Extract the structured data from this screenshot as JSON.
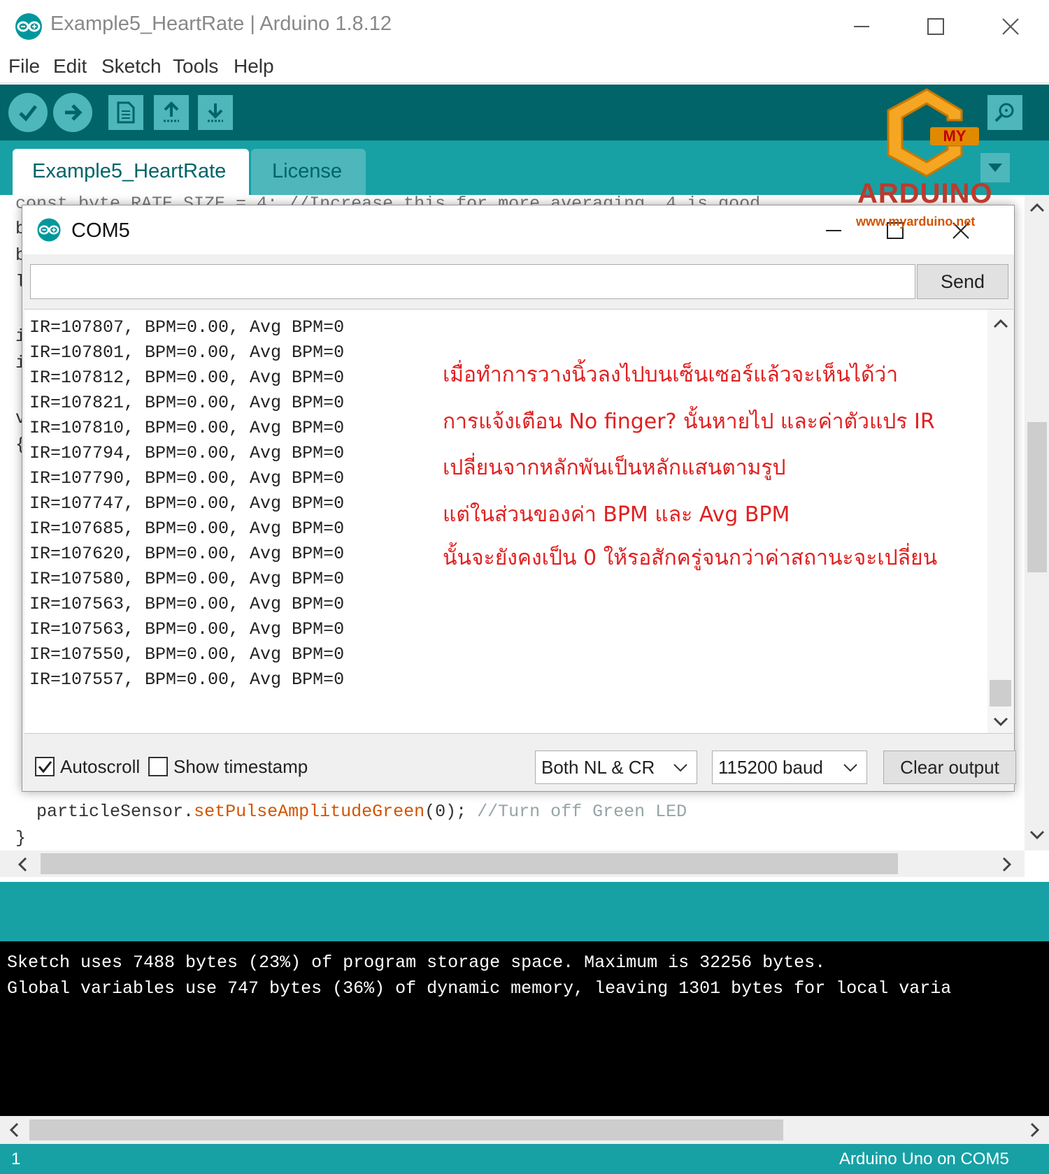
{
  "window": {
    "title": "Example5_HeartRate | Arduino 1.8.12"
  },
  "menu": [
    "File",
    "Edit",
    "Sketch",
    "Tools",
    "Help"
  ],
  "toolbar": {
    "buttons": [
      "verify-icon",
      "upload-icon",
      "new-icon",
      "open-icon",
      "save-icon"
    ],
    "serial_monitor_icon": "magnifier-icon"
  },
  "tabs": [
    {
      "label": "Example5_HeartRate",
      "active": true
    },
    {
      "label": "License",
      "active": false
    }
  ],
  "editor": {
    "top_line": "const byte RATE_SIZE = 4; //Increase this for more averaging. 4 is good.",
    "gutter_fragments": [
      "b",
      "b",
      "l",
      "i",
      "i",
      "v",
      "{"
    ],
    "line_call_object": "particleSensor",
    "line_call_dot": ".",
    "line_call_method": "setPulseAmplitudeGreen",
    "line_call_args": "(0); ",
    "line_call_comment": "//Turn off Green LED",
    "closing_brace": "}"
  },
  "serial_monitor": {
    "title": "COM5",
    "input_value": "",
    "send_label": "Send",
    "output_lines": [
      "IR=107807, BPM=0.00, Avg BPM=0",
      "IR=107801, BPM=0.00, Avg BPM=0",
      "IR=107812, BPM=0.00, Avg BPM=0",
      "IR=107821, BPM=0.00, Avg BPM=0",
      "IR=107810, BPM=0.00, Avg BPM=0",
      "IR=107794, BPM=0.00, Avg BPM=0",
      "IR=107790, BPM=0.00, Avg BPM=0",
      "IR=107747, BPM=0.00, Avg BPM=0",
      "IR=107685, BPM=0.00, Avg BPM=0",
      "IR=107620, BPM=0.00, Avg BPM=0",
      "IR=107580, BPM=0.00, Avg BPM=0",
      "IR=107563, BPM=0.00, Avg BPM=0",
      "IR=107563, BPM=0.00, Avg BPM=0",
      "IR=107550, BPM=0.00, Avg BPM=0",
      "IR=107557, BPM=0.00, Avg BPM=0"
    ],
    "annotation_lines": [
      "เมื่อทำการวางนิ้วลงไปบนเซ็นเซอร์แล้วจะเห็นได้ว่า",
      "การแจ้งเตือน No finger? นั้นหายไป และค่าตัวแปร IR",
      "เปลี่ยนจากหลักพันเป็นหลักแสนตามรูป",
      "แต่ในส่วนของค่า BPM และ Avg BPM",
      "นั้นจะยังคงเป็น 0 ให้รอสักครู่จนกว่าค่าสถานะจะเปลี่ยน"
    ],
    "autoscroll_label": "Autoscroll",
    "autoscroll_checked": true,
    "timestamp_label": "Show timestamp",
    "timestamp_checked": false,
    "line_ending": "Both NL & CR",
    "baud": "115200 baud",
    "clear_label": "Clear output"
  },
  "console": {
    "lines": [
      "Sketch uses 7488 bytes (23%) of program storage space. Maximum is 32256 bytes.",
      "Global variables use 747 bytes (36%) of dynamic memory, leaving 1301 bytes for local varia"
    ]
  },
  "status": {
    "line_number": "1",
    "board": "Arduino Uno on COM5"
  },
  "watermark": {
    "brand_top": "MY",
    "brand_main": "ARDUINO",
    "url": "www.myarduino.net"
  },
  "colors": {
    "toolbar": "#006468",
    "tabbar": "#17a1a5",
    "button": "#4db7bb",
    "annotation": "#e02020",
    "code_method": "#d35400",
    "code_comment": "#95a5a6"
  }
}
